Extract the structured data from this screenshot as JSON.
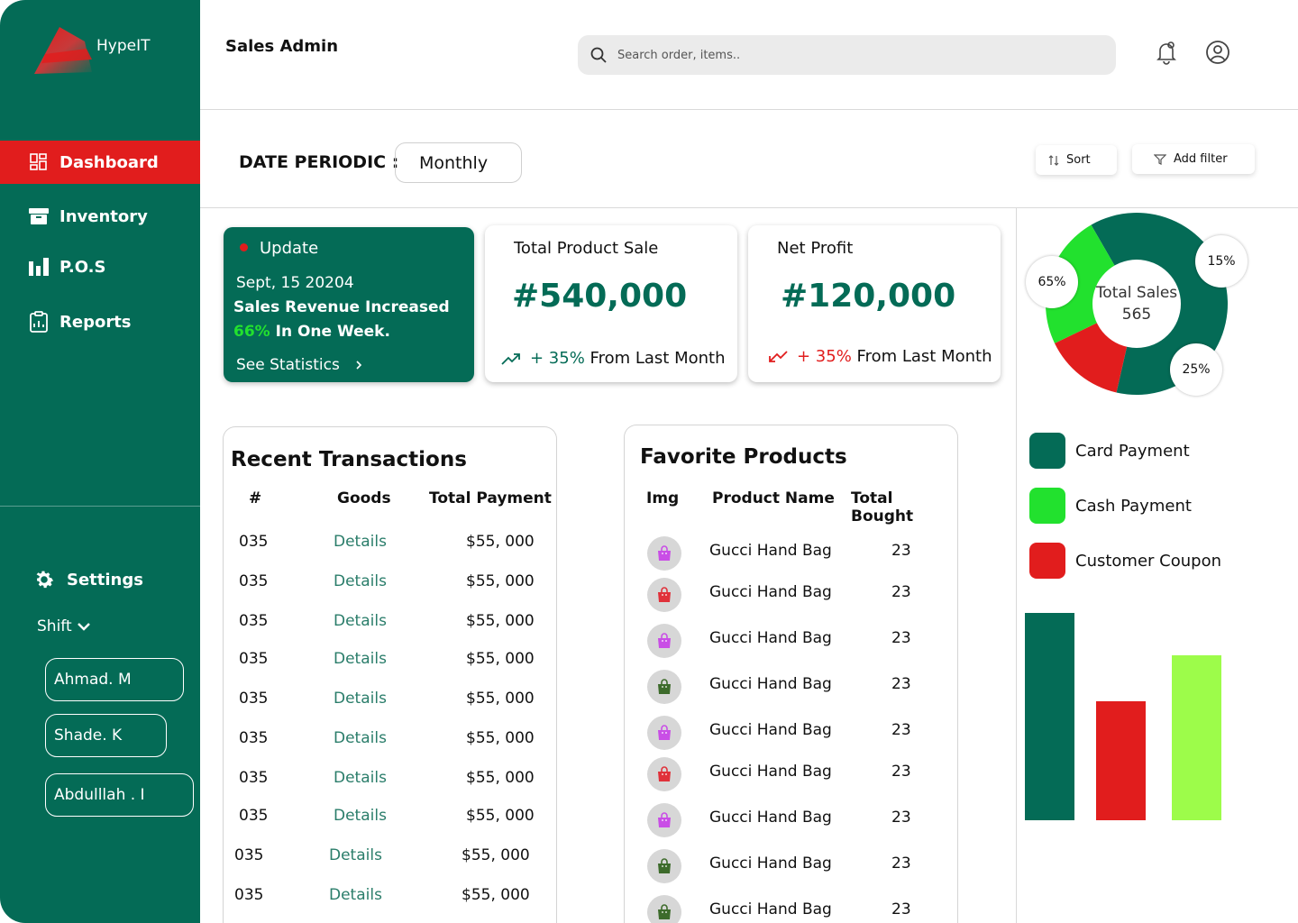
{
  "app": {
    "name": "HypeIT",
    "page_title": "Sales Admin"
  },
  "search": {
    "placeholder": "Search order, items.."
  },
  "sidebar": {
    "items": [
      {
        "label": "Dashboard",
        "icon": "dashboard-icon",
        "active": true
      },
      {
        "label": "Inventory",
        "icon": "archive-box-icon",
        "active": false
      },
      {
        "label": "P.O.S",
        "icon": "bar-chart-icon",
        "active": false
      },
      {
        "label": "Reports",
        "icon": "clipboard-icon",
        "active": false
      }
    ],
    "settings_label": "Settings",
    "shift_label": "Shift",
    "staff": [
      "Ahmad. M",
      "Shade. K",
      "Abdulllah . I"
    ]
  },
  "filters": {
    "date_label": "DATE PERIODIC :",
    "date_value": "Monthly",
    "sort_label": "Sort",
    "filter_label": "Add filter"
  },
  "update_card": {
    "title": "Update",
    "date": "Sept, 15 20204",
    "message_line1": "Sales Revenue Increased",
    "message_pct": "66%",
    "message_line2": "In One Week.",
    "link": "See Statistics"
  },
  "stats": [
    {
      "title": "Total Product Sale",
      "value": "#540,000",
      "trend_pct": "+ 35%",
      "trend_text": "From Last Month",
      "direction": "up"
    },
    {
      "title": "Net Profit",
      "value": "#120,000",
      "trend_pct": "+ 35%",
      "trend_text": "From Last Month",
      "direction": "down"
    }
  ],
  "transactions": {
    "title": "Recent Transactions",
    "headers": [
      "#",
      "Goods",
      "Total Payment"
    ],
    "rows": [
      {
        "id": "035",
        "goods": "Details",
        "payment": "$55, 000"
      },
      {
        "id": "035",
        "goods": "Details",
        "payment": "$55, 000"
      },
      {
        "id": "035",
        "goods": "Details",
        "payment": "$55, 000"
      },
      {
        "id": "035",
        "goods": "Details",
        "payment": "$55, 000"
      },
      {
        "id": "035",
        "goods": "Details",
        "payment": "$55, 000"
      },
      {
        "id": "035",
        "goods": "Details",
        "payment": "$55, 000"
      },
      {
        "id": "035",
        "goods": "Details",
        "payment": "$55, 000"
      },
      {
        "id": "035",
        "goods": "Details",
        "payment": "$55, 000"
      },
      {
        "id": "035",
        "goods": "Details",
        "payment": "$55, 000"
      },
      {
        "id": "035",
        "goods": "Details",
        "payment": "$55, 000"
      }
    ]
  },
  "favorites": {
    "title": "Favorite Products",
    "headers": [
      "Img",
      "Product Name",
      "Total Bought"
    ],
    "rows": [
      {
        "bag_color": "#c94ee6",
        "name": "Gucci Hand Bag",
        "bought": "23"
      },
      {
        "bag_color": "#e0313a",
        "name": "Gucci Hand Bag",
        "bought": "23"
      },
      {
        "bag_color": "#c94ee6",
        "name": "Gucci Hand Bag",
        "bought": "23"
      },
      {
        "bag_color": "#3d6b2b",
        "name": "Gucci Hand Bag",
        "bought": "23"
      },
      {
        "bag_color": "#c94ee6",
        "name": "Gucci Hand Bag",
        "bought": "23"
      },
      {
        "bag_color": "#e0313a",
        "name": "Gucci Hand Bag",
        "bought": "23"
      },
      {
        "bag_color": "#c94ee6",
        "name": "Gucci Hand Bag",
        "bought": "23"
      },
      {
        "bag_color": "#3d6b2b",
        "name": "Gucci Hand Bag",
        "bought": "23"
      },
      {
        "bag_color": "#3d6b2b",
        "name": "Gucci Hand Bag",
        "bought": "23"
      }
    ]
  },
  "payment_breakdown": {
    "center_label": "Total Sales",
    "center_value": "565",
    "segments": [
      {
        "label": "Card Payment",
        "percent": 65,
        "percent_label": "65%",
        "color": "#046b56"
      },
      {
        "label": "Customer Coupon",
        "percent": 15,
        "percent_label": "15%",
        "color": "#e11d1d"
      },
      {
        "label": "Cash Payment",
        "percent": 25,
        "percent_label": "25%",
        "color": "#22e12e"
      }
    ],
    "legend": [
      {
        "label": "Card Payment",
        "color": "#046b56"
      },
      {
        "label": "Cash Payment",
        "color": "#22e12e"
      },
      {
        "label": "Customer Coupon",
        "color": "#e11d1d"
      }
    ]
  },
  "mini_bars": [
    {
      "color": "#046b56",
      "value": 230
    },
    {
      "color": "#e11d1d",
      "value": 132
    },
    {
      "color": "#9dfc4a",
      "value": 183
    }
  ],
  "colors": {
    "brand": "#046b56",
    "accent": "#e11d1d",
    "positive": "#22e12e"
  }
}
